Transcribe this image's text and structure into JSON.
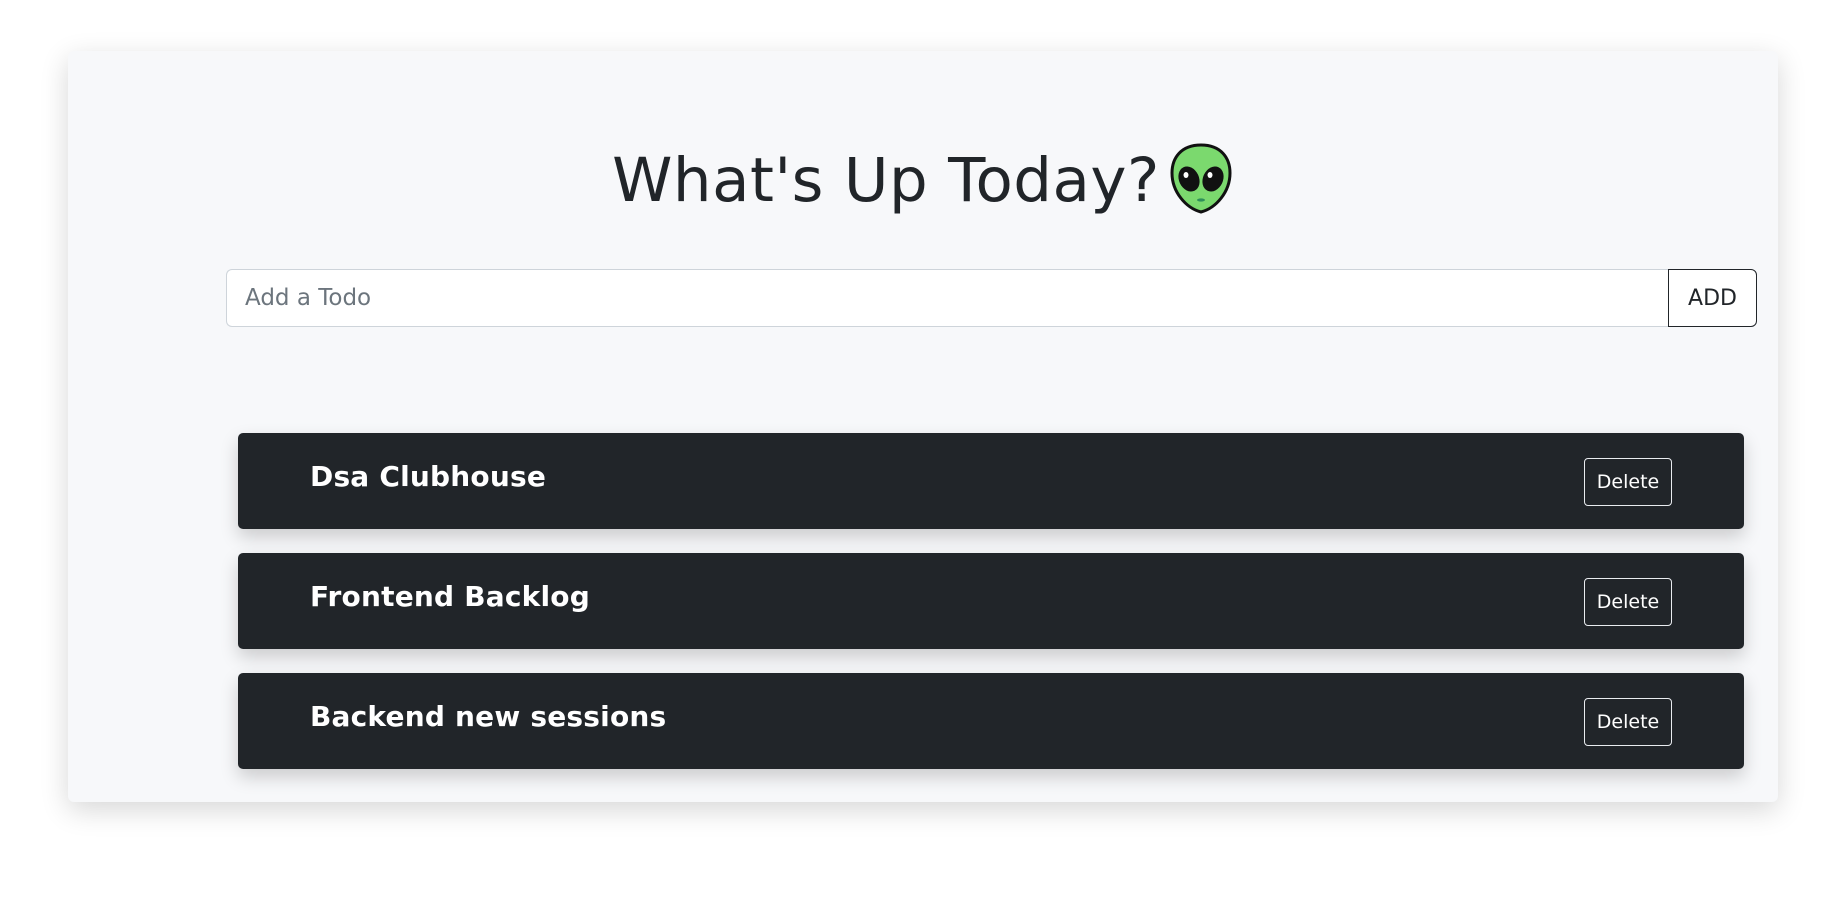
{
  "header": {
    "title": "What's Up Today?"
  },
  "form": {
    "placeholder": "Add a Todo",
    "value": "",
    "add_label": "ADD"
  },
  "todos": [
    {
      "text": "Dsa Clubhouse",
      "delete_label": "Delete"
    },
    {
      "text": "Frontend Backlog",
      "delete_label": "Delete"
    },
    {
      "text": "Backend new sessions",
      "delete_label": "Delete"
    }
  ],
  "icons": {
    "title_emoji": "alien-icon"
  },
  "colors": {
    "page_background": "#ffffff",
    "card_background": "#f7f8fa",
    "todo_background": "#212529",
    "text_dark": "#212529",
    "text_light": "#ffffff",
    "alien_green": "#7bd96e"
  }
}
